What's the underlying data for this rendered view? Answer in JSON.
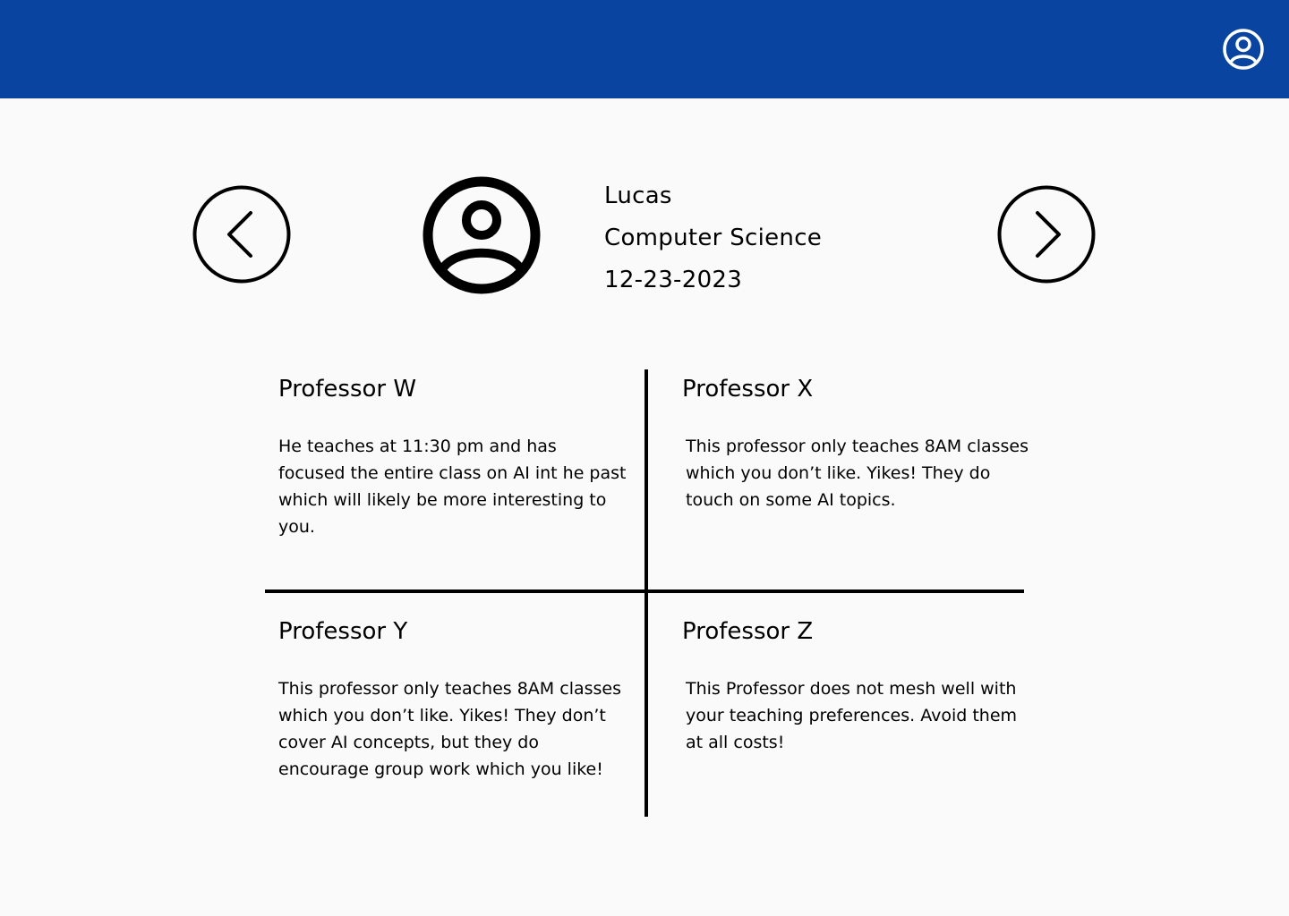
{
  "header": {
    "account_icon": "user-circle-icon",
    "color": "#0945a0"
  },
  "navigation": {
    "prev_icon": "chevron-left-circle-icon",
    "next_icon": "chevron-right-circle-icon"
  },
  "profile": {
    "avatar_icon": "user-circle-icon",
    "name": "Lucas",
    "major": "Computer Science",
    "date": "12-23-2023"
  },
  "professors": [
    {
      "name": "Professor W",
      "description": "He teaches at 11:30 pm and has focused the entire class on AI int he past which will likely be more interesting to you."
    },
    {
      "name": "Professor X",
      "description": "This professor only teaches 8AM classes which you don’t like. Yikes! They do touch on some AI topics."
    },
    {
      "name": "Professor Y",
      "description": "This professor only teaches 8AM classes which you don’t like. Yikes! They don’t cover AI concepts, but they do encourage group work which you like!"
    },
    {
      "name": "Professor Z",
      "description": "This Professor does not mesh well with your teaching preferences. Avoid them at all costs!"
    }
  ]
}
